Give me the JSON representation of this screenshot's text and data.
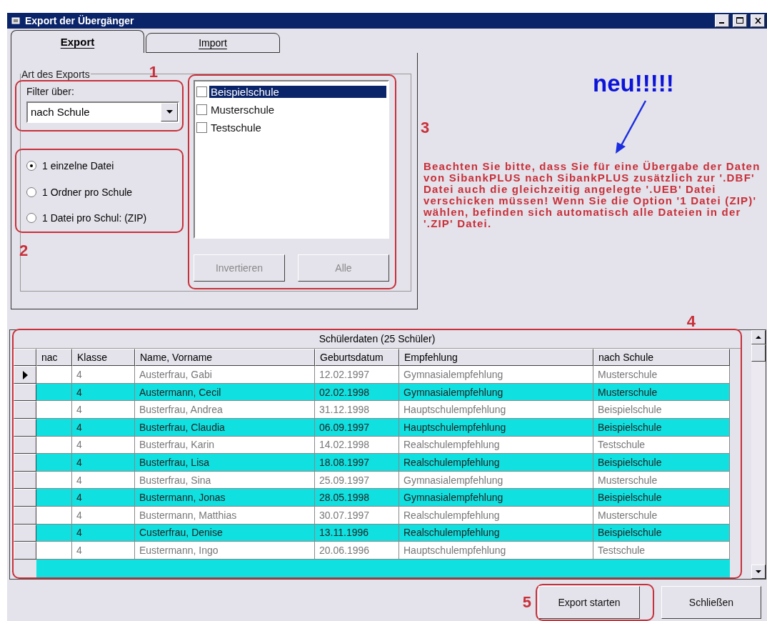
{
  "window": {
    "title": "Export der Übergänger"
  },
  "tabs": [
    {
      "label": "Export",
      "selected": true
    },
    {
      "label": "Import",
      "selected": false
    }
  ],
  "export_group": {
    "title": "Art des Exports",
    "filter_label": "Filter über:",
    "filter_value": "nach Schule",
    "options": [
      {
        "label": "1 einzelne Datei",
        "selected": true
      },
      {
        "label": "1 Ordner pro Schule",
        "selected": false
      },
      {
        "label": "1 Datei pro Schul: (ZIP)",
        "selected": false
      }
    ],
    "schools": [
      {
        "label": "Beispielschule",
        "checked": false,
        "selected": true
      },
      {
        "label": "Musterschule",
        "checked": false,
        "selected": false
      },
      {
        "label": "Testschule",
        "checked": false,
        "selected": false
      }
    ],
    "buttons": [
      {
        "label": "Invertieren",
        "disabled": true
      },
      {
        "label": "Alle",
        "disabled": true
      }
    ]
  },
  "notice": {
    "badge": "neu!!!!!",
    "text": "Beachten Sie bitte, dass Sie für eine Übergabe der Daten von SibankPLUS nach SibankPLUS zusätzlich zur '.DBF' Datei auch die gleichzeitig angelegte '.UEB' Datei verschicken müssen! Wenn Sie die Option '1 Datei (ZIP)' wählen, befinden sich automatisch alle Dateien in der '.ZIP' Datei."
  },
  "annotations": [
    "1",
    "2",
    "3",
    "4",
    "5"
  ],
  "table": {
    "caption": "Schülerdaten (25 Schüler)",
    "columns": [
      "nac",
      "Klasse",
      "Name, Vorname",
      "Geburtsdatum",
      "Empfehlung",
      "nach Schule"
    ],
    "rows": [
      {
        "current": true,
        "cells": [
          "",
          "4",
          "Austerfrau, Gabi",
          "12.02.1997",
          "Gymnasialempfehlung",
          "Musterschule"
        ]
      },
      {
        "current": false,
        "cells": [
          "",
          "4",
          "Austermann, Cecil",
          "02.02.1998",
          "Gymnasialempfehlung",
          "Musterschule"
        ]
      },
      {
        "current": false,
        "cells": [
          "",
          "4",
          "Busterfrau, Andrea",
          "31.12.1998",
          "Hauptschulempfehlung",
          "Beispielschule"
        ]
      },
      {
        "current": false,
        "cells": [
          "",
          "4",
          "Busterfrau, Claudia",
          "06.09.1997",
          "Hauptschulempfehlung",
          "Beispielschule"
        ]
      },
      {
        "current": false,
        "cells": [
          "",
          "4",
          "Busterfrau, Karin",
          "14.02.1998",
          "Realschulempfehlung",
          "Testschule"
        ]
      },
      {
        "current": false,
        "cells": [
          "",
          "4",
          "Busterfrau, Lisa",
          "18.08.1997",
          "Realschulempfehlung",
          "Beispielschule"
        ]
      },
      {
        "current": false,
        "cells": [
          "",
          "4",
          "Busterfrau, Sina",
          "25.09.1997",
          "Gymnasialempfehlung",
          "Musterschule"
        ]
      },
      {
        "current": false,
        "cells": [
          "",
          "4",
          "Bustermann, Jonas",
          "28.05.1998",
          "Gymnasialempfehlung",
          "Beispielschule"
        ]
      },
      {
        "current": false,
        "cells": [
          "",
          "4",
          "Bustermann, Matthias",
          "30.07.1997",
          "Realschulempfehlung",
          "Musterschule"
        ]
      },
      {
        "current": false,
        "cells": [
          "",
          "4",
          "Custerfrau, Denise",
          "13.11.1996",
          "Realschulempfehlung",
          "Beispielschule"
        ]
      },
      {
        "current": false,
        "cells": [
          "",
          "4",
          "Eustermann, Ingo",
          "20.06.1996",
          "Hauptschulempfehlung",
          "Testschule"
        ]
      }
    ]
  },
  "buttons": [
    {
      "label": "Export starten",
      "kind": "primary"
    },
    {
      "label": "Schließen",
      "kind": "normal"
    }
  ]
}
